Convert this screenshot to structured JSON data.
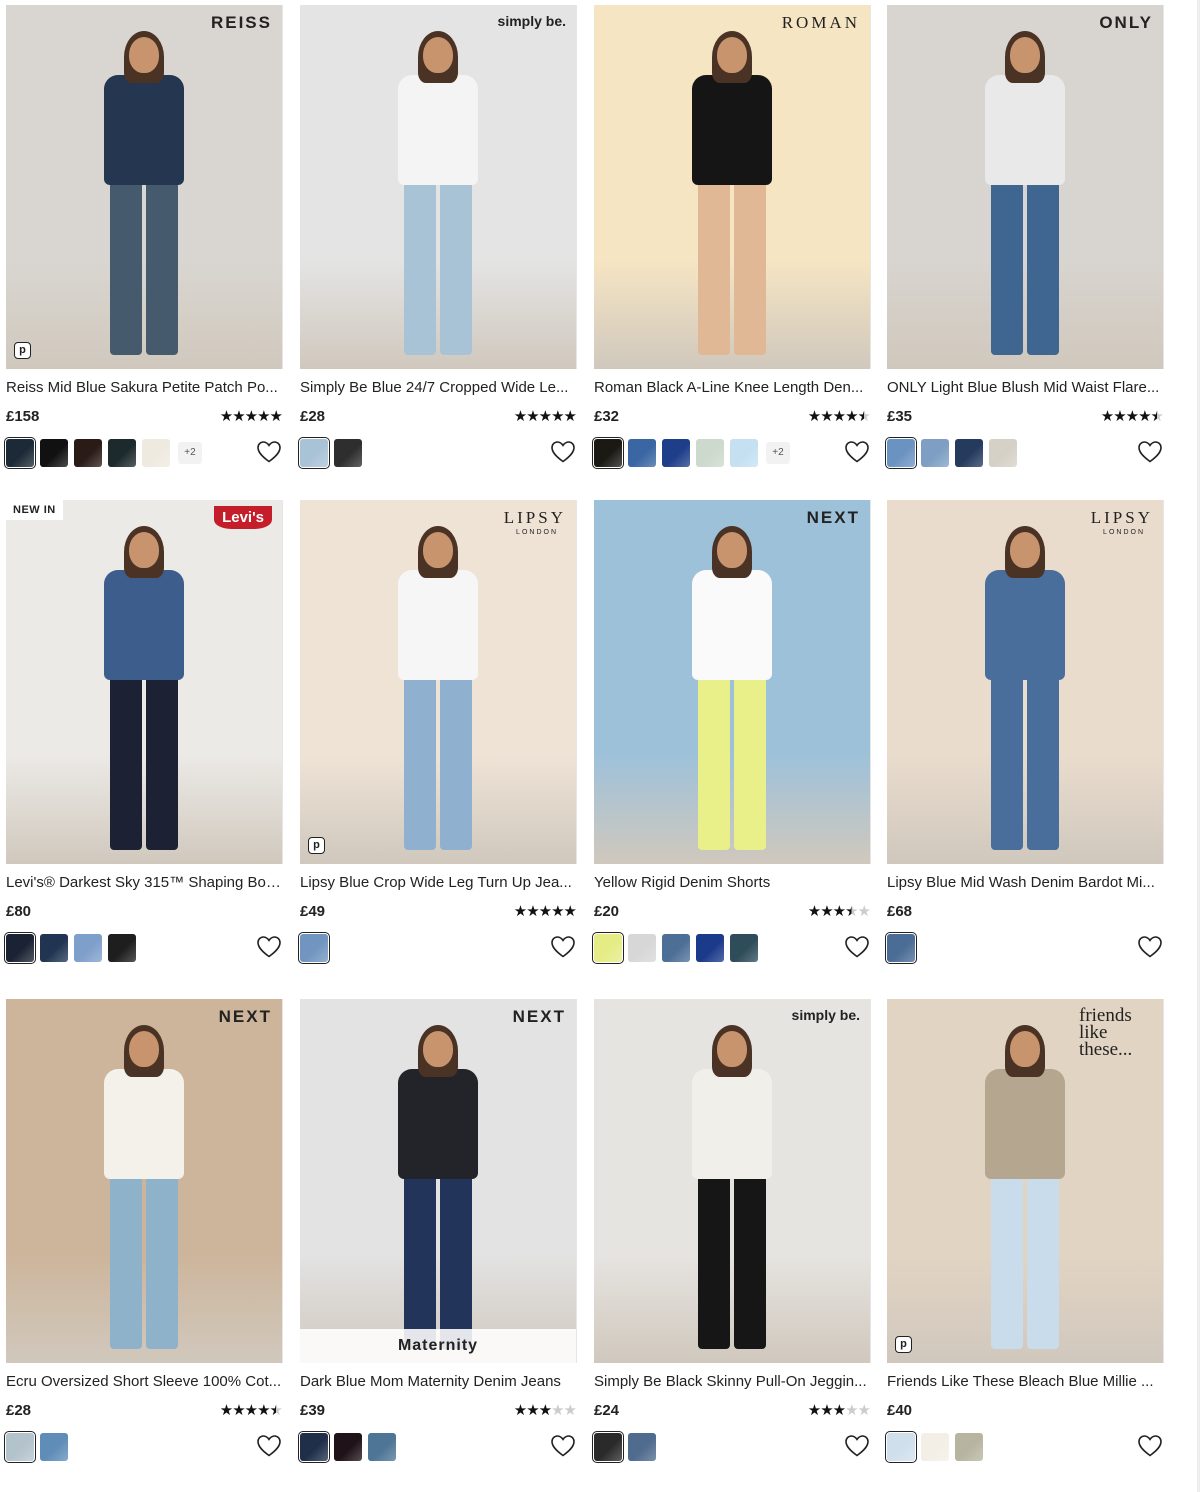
{
  "products": [
    {
      "brand": "REISS",
      "title": "Reiss Mid Blue Sakura Petite Patch Po...",
      "price": "£158",
      "rating": 5,
      "swatches": [
        "#1b2a36",
        "#111111",
        "#2b1b17",
        "#1d2a2d",
        "#efeae0"
      ],
      "more": "+2",
      "pay": true,
      "bg": "#d9d6d1",
      "jacket": "#243650",
      "pants": "#455b6d"
    },
    {
      "brand": "simply be.",
      "title": "Simply Be Blue 24/7 Cropped Wide Le...",
      "price": "£28",
      "rating": 5,
      "swatches": [
        "#a9c3d6",
        "#2e2e2e"
      ],
      "bg": "#e4e4e4",
      "jacket": "#f4f4f4",
      "pants": "#a9c3d6"
    },
    {
      "brand": "ROMAN",
      "title": "Roman Black A-Line Knee Length Den...",
      "price": "£32",
      "rating": 4.5,
      "swatches": [
        "#1b1914",
        "#3a66a3",
        "#1e3e8a",
        "#cdd9cc",
        "#c4e0f1"
      ],
      "more": "+2",
      "bg": "#f6e5c3",
      "jacket": "#151515",
      "pants": "#e0b895"
    },
    {
      "brand": "ONLY",
      "title": "ONLY Light Blue Blush Mid Waist Flare...",
      "price": "£35",
      "rating": 4.5,
      "swatches": [
        "#6b93c1",
        "#7e9fc3",
        "#253b5e",
        "#d6d1c6"
      ],
      "bg": "#d8d4cf",
      "jacket": "#e9e9e9",
      "pants": "#3f6591"
    },
    {
      "brand": "Levi's",
      "badge": "NEW IN",
      "title": "Levi's® Darkest Sky 315™ Shaping Boo...",
      "price": "£80",
      "rating": 0,
      "swatches": [
        "#1a2233",
        "#213553",
        "#7f9fcb",
        "#1e1e1e"
      ],
      "bg": "#eceae6",
      "jacket": "#3d5d8c",
      "pants": "#1c2234"
    },
    {
      "brand": "LIPSY",
      "brand_sub": "LONDON",
      "title": "Lipsy Blue Crop Wide Leg Turn Up Jea...",
      "price": "£49",
      "rating": 5,
      "swatches": [
        "#7195c0"
      ],
      "pay": true,
      "bg": "#efe3d6",
      "jacket": "#f6f6f6",
      "pants": "#8fb0cf"
    },
    {
      "brand": "NEXT",
      "title": "Yellow Rigid Denim Shorts",
      "price": "£20",
      "rating": 3.5,
      "swatches": [
        "#e5ec86",
        "#d7d7d7",
        "#4d6f96",
        "#1c3a8a",
        "#2e4c5a"
      ],
      "bg": "#9ec1da",
      "jacket": "#fafafa",
      "pants": "#e9f08a"
    },
    {
      "brand": "LIPSY",
      "brand_sub": "LONDON",
      "title": "Lipsy Blue Mid Wash Denim Bardot Mi...",
      "price": "£68",
      "rating": 0,
      "swatches": [
        "#4a6c95"
      ],
      "bg": "#e9dccd",
      "jacket": "#4a6e9b",
      "pants": "#4a6e9b"
    },
    {
      "brand": "NEXT",
      "title": "Ecru Oversized Short Sleeve 100% Cot...",
      "price": "£28",
      "rating": 4.5,
      "swatches": [
        "#b3c3cc",
        "#5f8db8"
      ],
      "bg": "#cdb59b",
      "jacket": "#f3f1ea",
      "pants": "#8eb2c9"
    },
    {
      "brand": "NEXT",
      "ribbon": "Maternity",
      "title": "Dark Blue Mom Maternity Denim Jeans",
      "price": "£39",
      "rating": 3,
      "swatches": [
        "#1f2f4a",
        "#1f1218",
        "#4e7595"
      ],
      "bg": "#e3e3e3",
      "jacket": "#23232a",
      "pants": "#22345a"
    },
    {
      "brand": "simply be.",
      "title": "Simply Be Black Skinny Pull-On Jeggin...",
      "price": "£24",
      "rating": 3,
      "swatches": [
        "#2a2a2a",
        "#4f6b8e"
      ],
      "bg": "#e6e4e1",
      "jacket": "#f1efe9",
      "pants": "#161616"
    },
    {
      "brand": "friends like these...",
      "title": "Friends Like These Bleach Blue Millie ...",
      "price": "£40",
      "rating": 0,
      "swatches": [
        "#cfe0ec",
        "#f3efe6",
        "#b7b5a0"
      ],
      "pay": true,
      "bg": "#e2d4c3",
      "jacket": "#b5a690",
      "pants": "#c8dcec"
    }
  ]
}
